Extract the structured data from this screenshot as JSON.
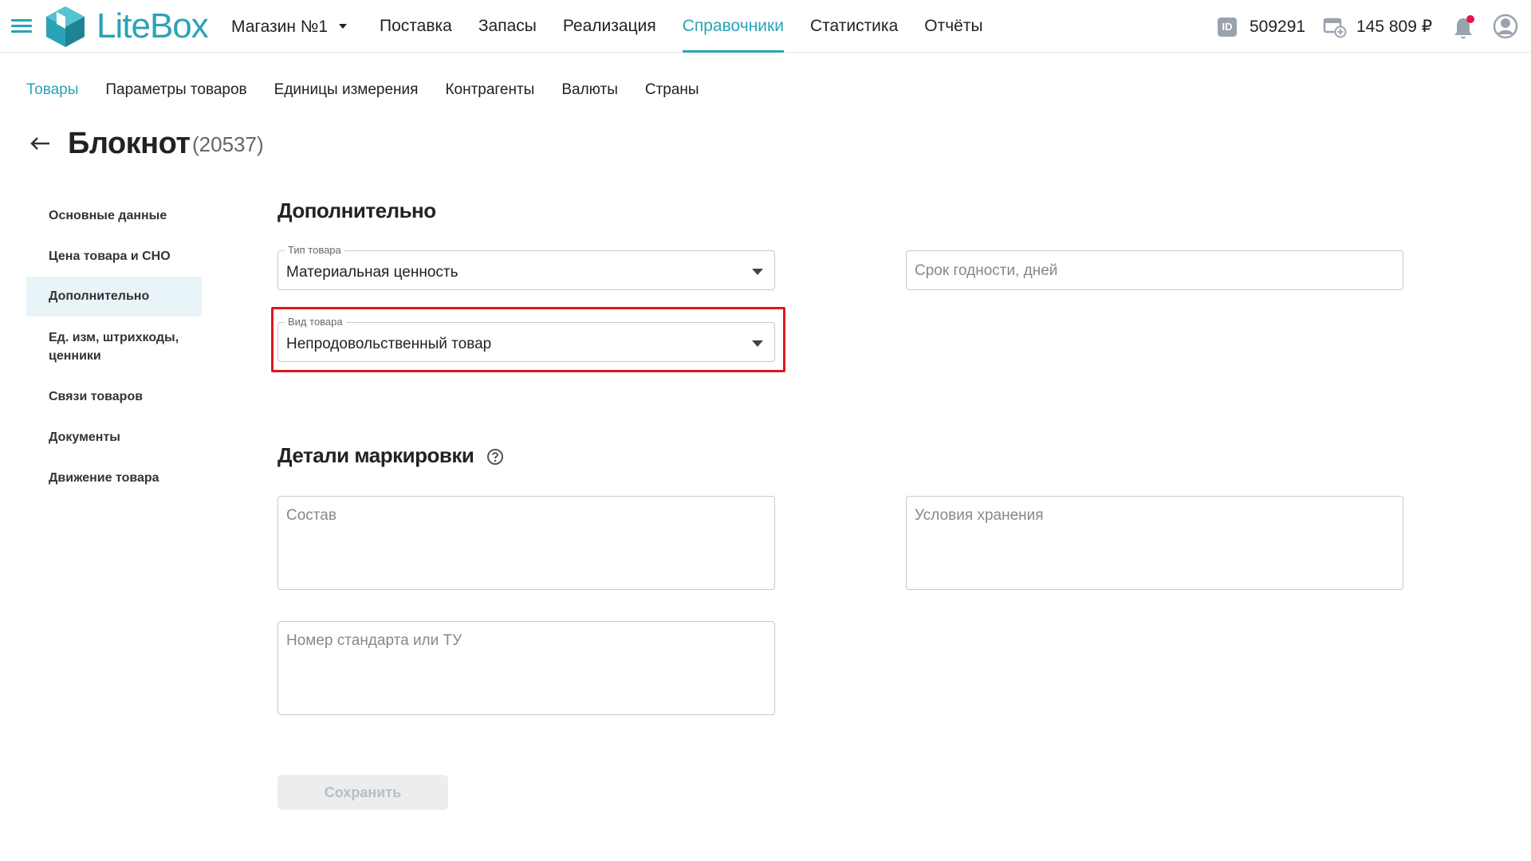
{
  "topbar": {
    "brand": "LiteBox",
    "store": "Магазин №1",
    "nav": [
      "Поставка",
      "Запасы",
      "Реализация",
      "Справочники",
      "Статистика",
      "Отчёты"
    ],
    "active_nav": "Справочники",
    "id_badge": "ID",
    "id_value": "509291",
    "balance": "145 809 ₽",
    "icons": [
      "menu-icon",
      "litebox-logo",
      "chevron-down-icon",
      "id-icon",
      "wallet-icon",
      "bell-icon",
      "user-icon"
    ],
    "accent_color": "#2aa3b6",
    "notification_dot_color": "#e0164b"
  },
  "subnav": {
    "items": [
      "Товары",
      "Параметры товаров",
      "Единицы измерения",
      "Контрагенты",
      "Валюты",
      "Страны"
    ],
    "active": "Товары"
  },
  "header": {
    "title": "Блокнот",
    "code": "(20537)"
  },
  "sidemenu": {
    "items": [
      "Основные данные",
      "Цена товара и СНО",
      "Дополнительно",
      "Ед. изм, штрихкоды, ценники",
      "Связи товаров",
      "Документы",
      "Движение товара"
    ],
    "active": "Дополнительно"
  },
  "section_additional": {
    "title": "Дополнительно",
    "product_type": {
      "label": "Тип товара",
      "value": "Материальная ценность"
    },
    "product_kind": {
      "label": "Вид товара",
      "value": "Непродовольственный товар"
    },
    "shelf_life": {
      "placeholder": "Срок годности, дней"
    }
  },
  "section_marking": {
    "title": "Детали маркировки",
    "composition": {
      "placeholder": "Состав"
    },
    "storage": {
      "placeholder": "Условия хранения"
    },
    "standard": {
      "placeholder": "Номер стандарта или ТУ"
    }
  },
  "save_button": "Сохранить",
  "highlight_color": "#e0161d"
}
